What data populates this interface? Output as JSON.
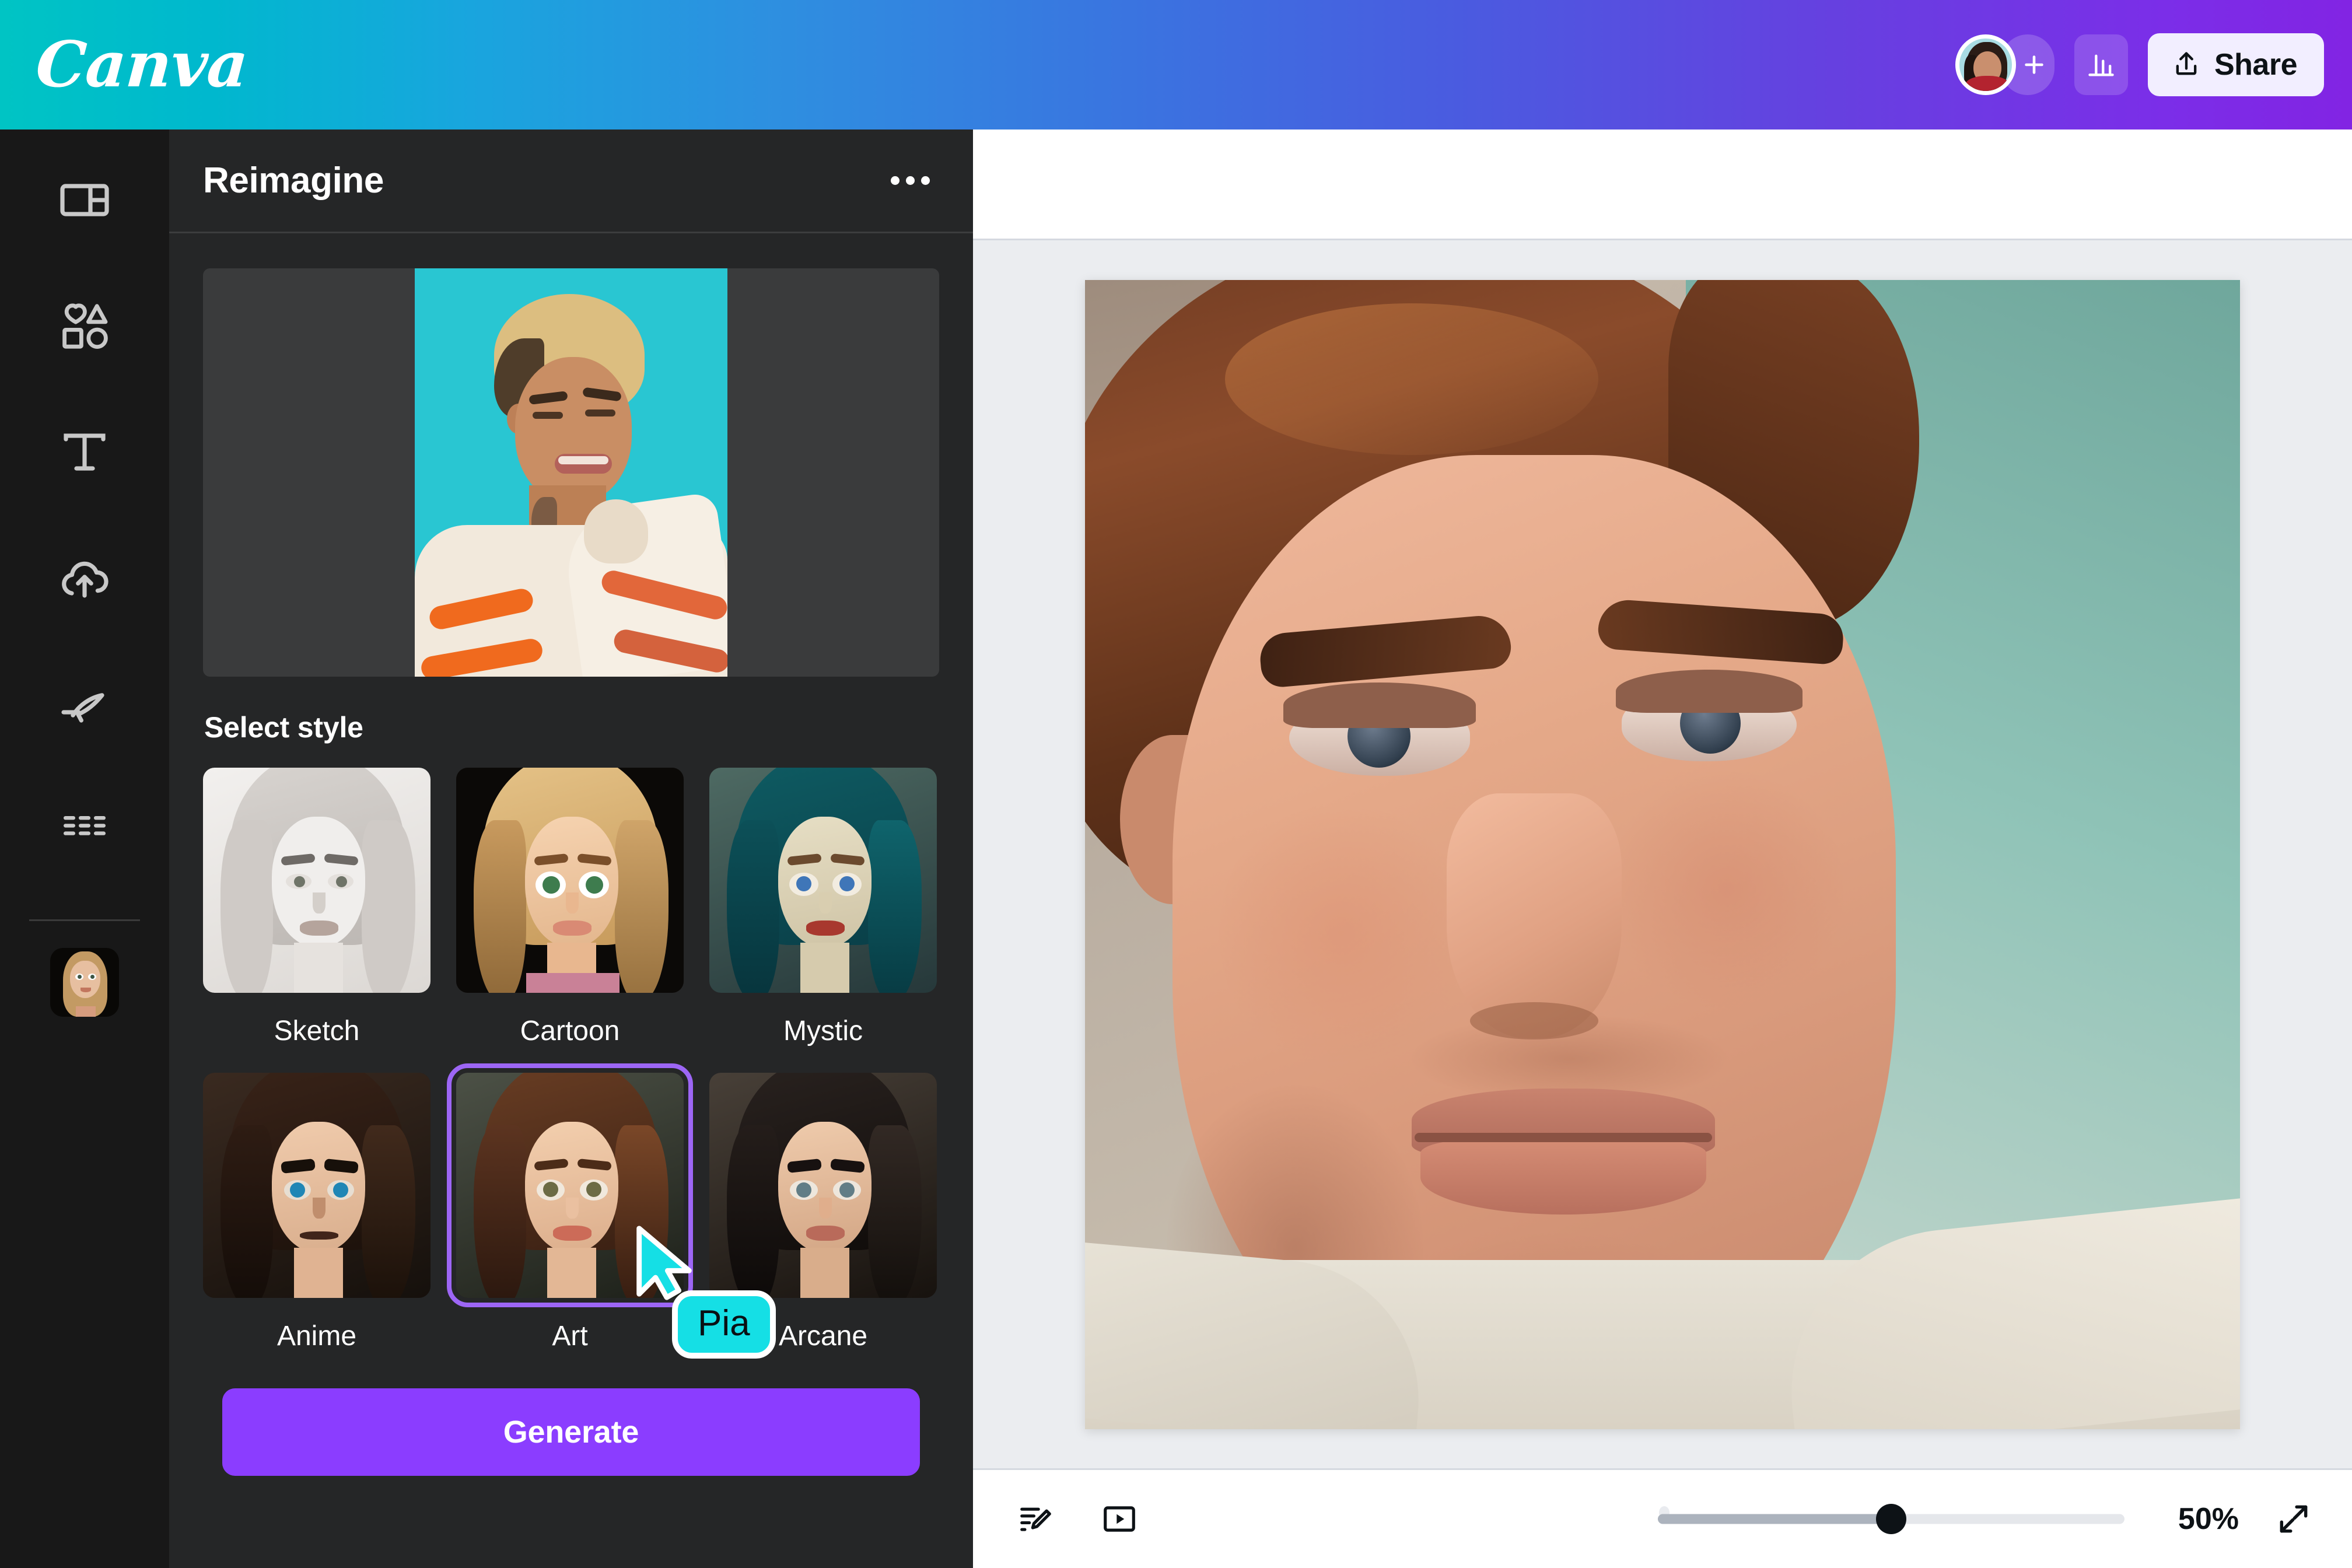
{
  "app": {
    "brand": "Canva",
    "brand_gradient_start": "#00C4C4",
    "brand_gradient_mid": "#3A74E0",
    "brand_gradient_end": "#8224E3",
    "accent_purple": "#8B3DFF",
    "selection_purple": "#9D66F5"
  },
  "header": {
    "logo_text": "Canva",
    "avatar_name": "avatar",
    "add_member_label": "+",
    "analytics_label": "Insights",
    "share_label": "Share"
  },
  "rail": {
    "items": [
      {
        "icon": "design-layout-icon",
        "name": "sidebar-item-design"
      },
      {
        "icon": "elements-shapes-icon",
        "name": "sidebar-item-elements"
      },
      {
        "icon": "text-icon",
        "name": "sidebar-item-text"
      },
      {
        "icon": "uploads-cloud-icon",
        "name": "sidebar-item-uploads"
      },
      {
        "icon": "draw-pen-icon",
        "name": "sidebar-item-draw"
      },
      {
        "icon": "apps-grid-icon",
        "name": "sidebar-item-apps"
      }
    ],
    "recent_app_thumb": "reimagine-app-thumbnail"
  },
  "panel": {
    "title": "Reimagine",
    "more_label": "...",
    "preview_alt": "Source photo: person with blond hair on teal background",
    "section_title": "Select style",
    "generate_label": "Generate",
    "styles": [
      {
        "label": "Sketch",
        "selected": false
      },
      {
        "label": "Cartoon",
        "selected": false
      },
      {
        "label": "Mystic",
        "selected": false
      },
      {
        "label": "Anime",
        "selected": false
      },
      {
        "label": "Art",
        "selected": true
      },
      {
        "label": "Arcane",
        "selected": false
      }
    ]
  },
  "canvas": {
    "document_alt": "Painted portrait of a person with brown hair on a teal background"
  },
  "bottombar": {
    "notes_label": "Notes",
    "present_label": "Present",
    "zoom_value": "50%",
    "zoom_percent": 50,
    "expand_label": "Fullscreen"
  },
  "cursor": {
    "collaborator_name": "Pia",
    "color": "#15DFE5"
  }
}
